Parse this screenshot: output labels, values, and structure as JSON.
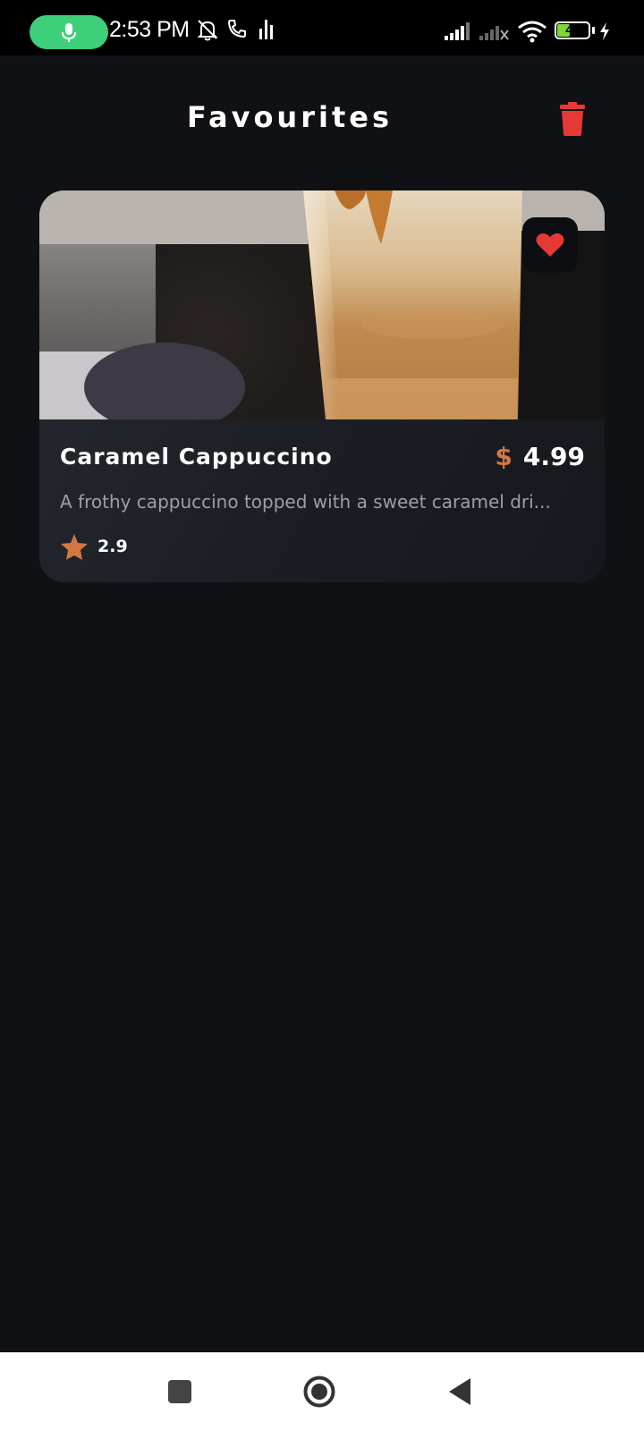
{
  "status_bar": {
    "time": "2:53 PM",
    "battery_level": "40",
    "battery_fraction": 0.4,
    "icons": [
      "mic-icon",
      "bell-off-icon",
      "phone-icon",
      "equalizer-icon",
      "signal-icon",
      "signal-no-service-icon",
      "wifi-icon",
      "battery-icon",
      "charging-icon"
    ],
    "colors": {
      "mic_pill": "#3ecf7a",
      "battery_fill": "#7fd63a"
    }
  },
  "header": {
    "title": "Favourites",
    "delete_icon": "trash-icon",
    "delete_color": "#e53935"
  },
  "favourites": [
    {
      "name": "Caramel Cappuccino",
      "currency": "$",
      "price": "4.99",
      "description": "A frothy cappuccino topped with a sweet caramel dri...",
      "rating": "2.9",
      "favourite_icon": "heart-icon",
      "favourite_color": "#e53935",
      "rating_icon": "star-icon",
      "accent_color": "#d17842"
    }
  ],
  "nav_bar": {
    "buttons": [
      "recents-square-icon",
      "home-circle-icon",
      "back-triangle-icon"
    ]
  }
}
